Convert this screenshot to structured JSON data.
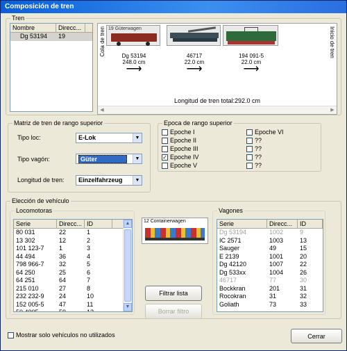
{
  "window": {
    "title": "Composición de tren"
  },
  "tren": {
    "group_label": "Tren",
    "columns": [
      "Nombre",
      "Direcc..."
    ],
    "rows": [
      [
        "Dg 53194",
        "19"
      ]
    ],
    "head_end": "Cola de tren",
    "tail_end": "Inicio de tren",
    "cars": [
      {
        "caption": "19 Güterwagen",
        "id": "Dg 53194",
        "length": "248.0 cm"
      },
      {
        "caption": "",
        "id": "46717",
        "length": "22.0 cm"
      },
      {
        "caption": "",
        "id": "194 091-5",
        "length": "22.0 cm"
      }
    ],
    "total": "Longitud de tren total:292.0 cm"
  },
  "matriz": {
    "group_label": "Matriz de tren de rango superior",
    "tipo_loc_label": "Tipo loc:",
    "tipo_loc_value": "E-Lok",
    "tipo_vagon_label": "Tipo vagón:",
    "tipo_vagon_value": "Güter",
    "longitud_label": "Longitud de tren:",
    "longitud_value": "Einzelfahrzeug"
  },
  "epoca": {
    "group_label": "Epoca de rango superior",
    "left": [
      {
        "label": "Epoche I",
        "checked": false
      },
      {
        "label": "Epoche II",
        "checked": false
      },
      {
        "label": "Epoche III",
        "checked": false
      },
      {
        "label": "Epoche IV",
        "checked": true
      },
      {
        "label": "Epoche V",
        "checked": false
      }
    ],
    "right": [
      {
        "label": "Epoche VI",
        "checked": false
      },
      {
        "label": "??",
        "checked": false
      },
      {
        "label": "??",
        "checked": false
      },
      {
        "label": "??",
        "checked": false
      },
      {
        "label": "??",
        "checked": false
      }
    ]
  },
  "eleccion": {
    "group_label": "Elección de vehículo",
    "loco_label": "Locomotoras",
    "loco_columns": [
      "Serie",
      "Direcc...",
      "ID"
    ],
    "loco_rows": [
      [
        "80 031",
        "22",
        "1"
      ],
      [
        "13 302",
        "12",
        "2"
      ],
      [
        "101 123-7",
        "1",
        "3"
      ],
      [
        "44 494",
        "36",
        "4"
      ],
      [
        "798 966-7",
        "32",
        "5"
      ],
      [
        "64 250",
        "25",
        "6"
      ],
      [
        "64 251",
        "64",
        "7"
      ],
      [
        "215 010",
        "27",
        "8"
      ],
      [
        "232 232-9",
        "24",
        "10"
      ],
      [
        "152 005-5",
        "47",
        "11"
      ],
      [
        "50 4005",
        "59",
        "12"
      ]
    ],
    "preview_caption": "12 Containerwagen",
    "wagon_label": "Vagones",
    "wagon_columns": [
      "Serie",
      "Direcc...",
      "ID"
    ],
    "wagon_rows": [
      [
        "Dg 53194",
        "1002",
        "9"
      ],
      [
        "IC 2571",
        "1003",
        "13"
      ],
      [
        "Sauger",
        "49",
        "15"
      ],
      [
        "E 2139",
        "1001",
        "20"
      ],
      [
        "Dg 42120",
        "1007",
        "22"
      ],
      [
        "Dg 533xx",
        "1004",
        "26"
      ],
      [
        "46717",
        "77",
        "30"
      ],
      [
        "Bockkran",
        "201",
        "31"
      ],
      [
        "Rocokran",
        "31",
        "32"
      ],
      [
        "Goliath",
        "73",
        "33"
      ]
    ],
    "filtrar": "Filtrar lista",
    "borrar": "Borrar filtro"
  },
  "footer": {
    "checkbox_label": "Mostrar solo vehículos no utilizados",
    "cerrar": "Cerrar"
  }
}
